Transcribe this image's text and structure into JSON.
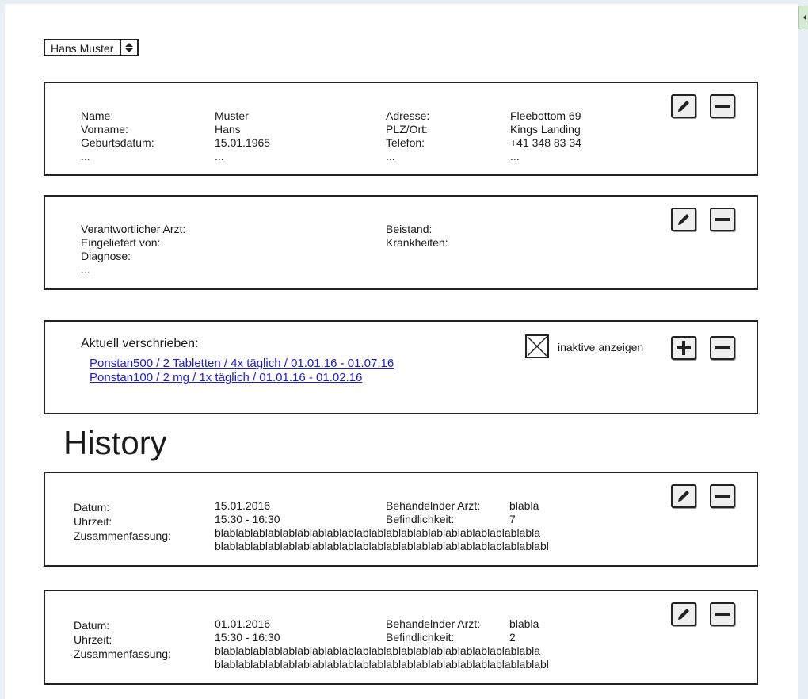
{
  "patient_select": {
    "value": "Hans Muster"
  },
  "personal": {
    "col1_labels": [
      "Name:",
      "Vorname:",
      "Geburtsdatum:",
      "..."
    ],
    "col1_values": [
      "Muster",
      "Hans",
      "15.01.1965",
      "..."
    ],
    "col2_labels": [
      "Adresse:",
      "PLZ/Ort:",
      "Telefon:",
      "..."
    ],
    "col2_values": [
      "Fleebottom 69",
      "Kings Landing",
      "+41 348 83 34",
      "..."
    ]
  },
  "medical": {
    "col1_labels": [
      "Verantwortlicher Arzt:",
      "Eingeliefert von:",
      "Diagnose:",
      "..."
    ],
    "col2_labels": [
      "Beistand:",
      "Krankheiten:"
    ]
  },
  "prescriptions": {
    "heading": "Aktuell verschrieben:",
    "items": [
      "Ponstan500 / 2 Tabletten / 4x täglich / 01.01.16 - 01.07.16",
      "Ponstan100 / 2 mg / 1x täglich / 01.01.16 - 01.02.16"
    ],
    "show_inactive_label": "inaktive anzeigen"
  },
  "history": {
    "title": "History",
    "entries": [
      {
        "labels": [
          "Datum:",
          "Uhrzeit:",
          "Zusammenfassung:"
        ],
        "datum": "15.01.2016",
        "uhrzeit": "15:30 - 16:30",
        "summary_line1": "blablablablablablablablablablablablablablablablablablablablablabla",
        "summary_line2": "blablablablablablablablablablablablablablablablablablablablablablabl",
        "arzt_label": "Behandelnder Arzt:",
        "arzt": "blabla",
        "befinden_label": "Befindlichkeit:",
        "befinden": "7"
      },
      {
        "labels": [
          "Datum:",
          "Uhrzeit:",
          "Zusammenfassung:"
        ],
        "datum": "01.01.2016",
        "uhrzeit": "15:30 - 16:30",
        "summary_line1": "blablablablablablablablablablablablablablablablablablablablablabla",
        "summary_line2": "blablablablablablablablablablablablablablablablablablablablablablabl",
        "arzt_label": "Behandelnder Arzt:",
        "arzt": "blabla",
        "befinden_label": "Befindlichkeit:",
        "befinden": "2"
      }
    ]
  },
  "icons": {
    "edit": "pencil-icon",
    "remove": "minus-icon",
    "add": "plus-icon",
    "select_arrows": "sort-arrows-icon",
    "checkbox": "checkbox-crossed-icon"
  },
  "colors": {
    "link": "#1a1ae0",
    "border": "#222222",
    "button_bg": "#eeeeee"
  }
}
